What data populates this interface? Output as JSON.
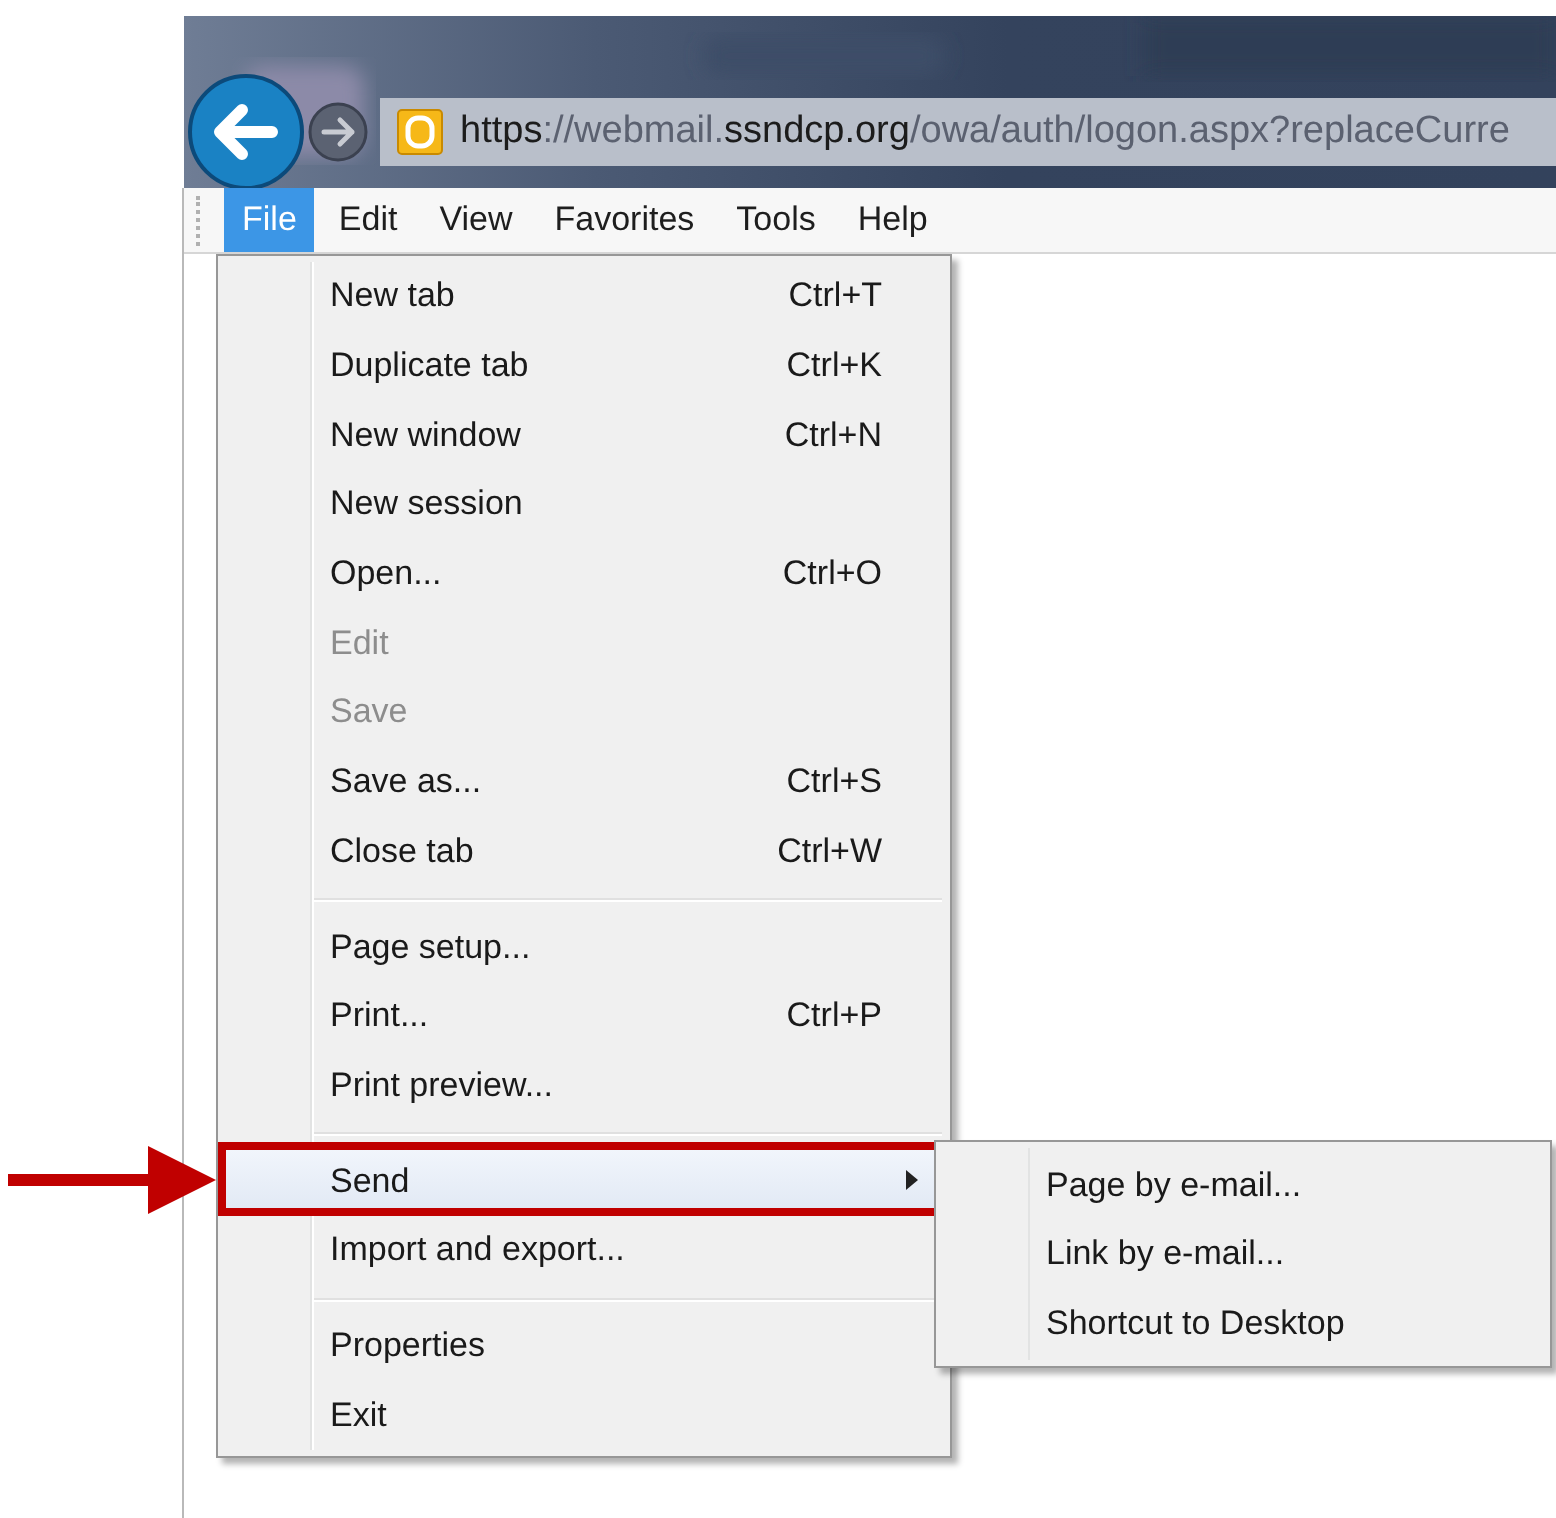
{
  "address_bar": {
    "url_parts": [
      {
        "text": "https",
        "strong": true
      },
      {
        "text": "://webmail.",
        "strong": false
      },
      {
        "text": "ssndcp.org",
        "strong": true
      },
      {
        "text": "/owa/auth/logon.aspx?replaceCurre",
        "strong": false
      }
    ]
  },
  "menu_bar": [
    {
      "label": "File",
      "selected": true
    },
    {
      "label": "Edit",
      "selected": false
    },
    {
      "label": "View",
      "selected": false
    },
    {
      "label": "Favorites",
      "selected": false
    },
    {
      "label": "Tools",
      "selected": false
    },
    {
      "label": "Help",
      "selected": false
    }
  ],
  "file_menu": [
    {
      "kind": "item",
      "label": "New tab",
      "shortcut": "Ctrl+T",
      "disabled": false,
      "highlighted": false
    },
    {
      "kind": "item",
      "label": "Duplicate tab",
      "shortcut": "Ctrl+K",
      "disabled": false,
      "highlighted": false
    },
    {
      "kind": "item",
      "label": "New window",
      "shortcut": "Ctrl+N",
      "disabled": false,
      "highlighted": false
    },
    {
      "kind": "item",
      "label": "New session",
      "disabled": false,
      "highlighted": false
    },
    {
      "kind": "item",
      "label": "Open...",
      "shortcut": "Ctrl+O",
      "disabled": false,
      "highlighted": false
    },
    {
      "kind": "item",
      "label": "Edit",
      "disabled": true,
      "highlighted": false
    },
    {
      "kind": "item",
      "label": "Save",
      "disabled": true,
      "highlighted": false
    },
    {
      "kind": "item",
      "label": "Save as...",
      "shortcut": "Ctrl+S",
      "disabled": false,
      "highlighted": false
    },
    {
      "kind": "item",
      "label": "Close tab",
      "shortcut": "Ctrl+W",
      "disabled": false,
      "highlighted": false
    },
    {
      "kind": "separator"
    },
    {
      "kind": "item",
      "label": "Page setup...",
      "disabled": false,
      "highlighted": false
    },
    {
      "kind": "item",
      "label": "Print...",
      "shortcut": "Ctrl+P",
      "disabled": false,
      "highlighted": false
    },
    {
      "kind": "item",
      "label": "Print preview...",
      "disabled": false,
      "highlighted": false
    },
    {
      "kind": "separator"
    },
    {
      "kind": "submenu",
      "label": "Send",
      "disabled": false,
      "highlighted": true
    },
    {
      "kind": "item",
      "label": "Import and export...",
      "disabled": false,
      "highlighted": false
    },
    {
      "kind": "separator"
    },
    {
      "kind": "item",
      "label": "Properties",
      "disabled": false,
      "highlighted": false
    },
    {
      "kind": "item",
      "label": "Exit",
      "disabled": false,
      "highlighted": false
    }
  ],
  "send_submenu": [
    {
      "label": "Page by e-mail..."
    },
    {
      "label": "Link by e-mail..."
    },
    {
      "label": "Shortcut to Desktop"
    }
  ]
}
